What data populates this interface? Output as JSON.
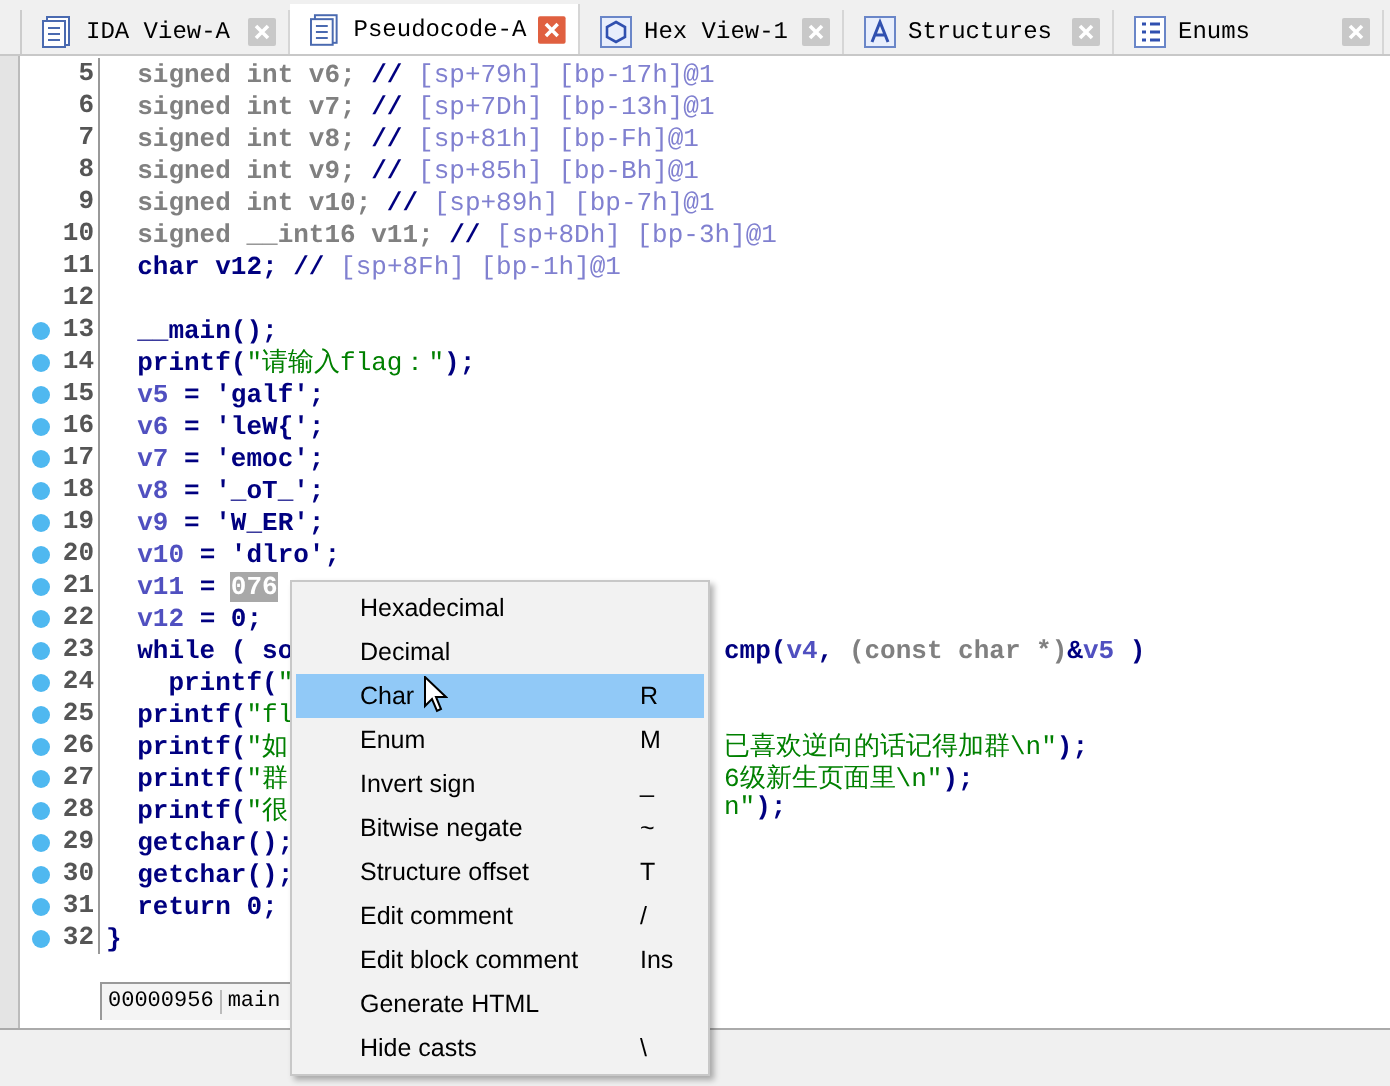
{
  "tabs": [
    {
      "label": "IDA View-A",
      "selected": false
    },
    {
      "label": "Pseudocode-A",
      "selected": true
    },
    {
      "label": "Hex View-1",
      "selected": false
    },
    {
      "label": "Structures",
      "selected": false
    },
    {
      "label": "Enums",
      "selected": false
    }
  ],
  "code": {
    "lines": [
      {
        "number": "5",
        "breakpoint": false,
        "segments": [
          {
            "t": "  signed int v6;",
            "kind": "decl"
          },
          {
            "t": " // ",
            "kind": "op"
          },
          {
            "t": "[sp+79h] [bp-17h]@1",
            "kind": "cmt"
          }
        ]
      },
      {
        "number": "6",
        "breakpoint": false,
        "segments": [
          {
            "t": "  signed int v7;",
            "kind": "decl"
          },
          {
            "t": " // ",
            "kind": "op"
          },
          {
            "t": "[sp+7Dh] [bp-13h]@1",
            "kind": "cmt"
          }
        ]
      },
      {
        "number": "7",
        "breakpoint": false,
        "segments": [
          {
            "t": "  signed int v8;",
            "kind": "decl"
          },
          {
            "t": " // ",
            "kind": "op"
          },
          {
            "t": "[sp+81h] [bp-Fh]@1",
            "kind": "cmt"
          }
        ]
      },
      {
        "number": "8",
        "breakpoint": false,
        "segments": [
          {
            "t": "  signed int v9;",
            "kind": "decl"
          },
          {
            "t": " // ",
            "kind": "op"
          },
          {
            "t": "[sp+85h] [bp-Bh]@1",
            "kind": "cmt"
          }
        ]
      },
      {
        "number": "9",
        "breakpoint": false,
        "segments": [
          {
            "t": "  signed int v10;",
            "kind": "decl"
          },
          {
            "t": " // ",
            "kind": "op"
          },
          {
            "t": "[sp+89h] [bp-7h]@1",
            "kind": "cmt"
          }
        ]
      },
      {
        "number": "10",
        "breakpoint": false,
        "segments": [
          {
            "t": "  signed __int16 v11;",
            "kind": "decl"
          },
          {
            "t": " // ",
            "kind": "op"
          },
          {
            "t": "[sp+8Dh] [bp-3h]@1",
            "kind": "cmt"
          }
        ]
      },
      {
        "number": "11",
        "breakpoint": false,
        "segments": [
          {
            "t": "  char v12;",
            "kind": "op"
          },
          {
            "t": " // ",
            "kind": "op"
          },
          {
            "t": "[sp+8Fh] [bp-1h]@1",
            "kind": "cmt"
          }
        ]
      },
      {
        "number": "12",
        "breakpoint": false
      },
      {
        "number": "13",
        "breakpoint": true,
        "segments": [
          {
            "t": "  __main();",
            "kind": "op"
          }
        ]
      },
      {
        "number": "14",
        "breakpoint": true,
        "segments": [
          {
            "t": "  printf(",
            "kind": "op"
          },
          {
            "t": "\"请输入flag：\"",
            "kind": "str"
          },
          {
            "t": ");",
            "kind": "op"
          }
        ]
      },
      {
        "number": "15",
        "breakpoint": true,
        "segments": [
          {
            "t": "  v5",
            "kind": "var"
          },
          {
            "t": " = 'galf';",
            "kind": "op"
          }
        ]
      },
      {
        "number": "16",
        "breakpoint": true,
        "segments": [
          {
            "t": "  v6",
            "kind": "var"
          },
          {
            "t": " = 'leW{';",
            "kind": "op"
          }
        ]
      },
      {
        "number": "17",
        "breakpoint": true,
        "segments": [
          {
            "t": "  v7",
            "kind": "var"
          },
          {
            "t": " = 'emoc';",
            "kind": "op"
          }
        ]
      },
      {
        "number": "18",
        "breakpoint": true,
        "segments": [
          {
            "t": "  v8",
            "kind": "var"
          },
          {
            "t": " = '_oT_';",
            "kind": "op"
          }
        ]
      },
      {
        "number": "19",
        "breakpoint": true,
        "segments": [
          {
            "t": "  v9",
            "kind": "var"
          },
          {
            "t": " = 'W_ER';",
            "kind": "op"
          }
        ]
      },
      {
        "number": "20",
        "breakpoint": true,
        "segments": [
          {
            "t": "  v10",
            "kind": "var"
          },
          {
            "t": " = 'dlro';",
            "kind": "op"
          }
        ]
      },
      {
        "number": "21",
        "breakpoint": true,
        "segments": [
          {
            "t": "  v11",
            "kind": "var"
          },
          {
            "t": " = ",
            "kind": "op"
          },
          {
            "t": "076",
            "kind": "sel"
          }
        ]
      },
      {
        "number": "22",
        "breakpoint": true,
        "segments": [
          {
            "t": "  v12",
            "kind": "var"
          },
          {
            "t": " = 0;",
            "kind": "op"
          }
        ]
      },
      {
        "number": "23",
        "breakpoint": true,
        "segments": [
          {
            "t": "  while ( so",
            "kind": "op"
          }
        ],
        "right": [
          {
            "t": "cmp(",
            "kind": "op"
          },
          {
            "t": "v4",
            "kind": "var"
          },
          {
            "t": ", ",
            "kind": "op"
          },
          {
            "t": "(const char *)",
            "kind": "decl"
          },
          {
            "t": "&",
            "kind": "op"
          },
          {
            "t": "v5",
            "kind": "var"
          },
          {
            "t": " )",
            "kind": "op"
          }
        ]
      },
      {
        "number": "24",
        "breakpoint": true,
        "segments": [
          {
            "t": "    printf(",
            "kind": "op"
          },
          {
            "t": "\"",
            "kind": "str"
          }
        ]
      },
      {
        "number": "25",
        "breakpoint": true,
        "segments": [
          {
            "t": "  printf(",
            "kind": "op"
          },
          {
            "t": "\"fl",
            "kind": "str"
          }
        ]
      },
      {
        "number": "26",
        "breakpoint": true,
        "segments": [
          {
            "t": "  printf(",
            "kind": "op"
          },
          {
            "t": "\"如",
            "kind": "str"
          }
        ],
        "right": [
          {
            "t": "已喜欢逆向的话记得加群\\n\"",
            "kind": "str"
          },
          {
            "t": ");",
            "kind": "op"
          }
        ]
      },
      {
        "number": "27",
        "breakpoint": true,
        "segments": [
          {
            "t": "  printf(",
            "kind": "op"
          },
          {
            "t": "\"群",
            "kind": "str"
          }
        ],
        "right": [
          {
            "t": "6级新生页面里\\n\"",
            "kind": "str"
          },
          {
            "t": ");",
            "kind": "op"
          }
        ]
      },
      {
        "number": "28",
        "breakpoint": true,
        "segments": [
          {
            "t": "  printf(",
            "kind": "op"
          },
          {
            "t": "\"很",
            "kind": "str"
          }
        ],
        "right": [
          {
            "t": "n\"",
            "kind": "str"
          },
          {
            "t": ");",
            "kind": "op"
          }
        ]
      },
      {
        "number": "29",
        "breakpoint": true,
        "segments": [
          {
            "t": "  getchar();",
            "kind": "op"
          }
        ]
      },
      {
        "number": "30",
        "breakpoint": true,
        "segments": [
          {
            "t": "  getchar();",
            "kind": "op"
          }
        ]
      },
      {
        "number": "31",
        "breakpoint": true,
        "segments": [
          {
            "t": "  return 0;",
            "kind": "op"
          }
        ]
      },
      {
        "number": "32",
        "breakpoint": true,
        "segments": [
          {
            "t": "}",
            "kind": "op"
          }
        ]
      }
    ]
  },
  "status": {
    "address": "00000956",
    "function": "main"
  },
  "context_menu": {
    "items": [
      {
        "label": "Hexadecimal",
        "selected": false
      },
      {
        "label": "Decimal",
        "selected": false
      },
      {
        "label": "Char",
        "shortcut": "R",
        "selected": true
      },
      {
        "label": "Enum",
        "shortcut": "M",
        "selected": false
      },
      {
        "label": "Invert sign",
        "shortcut": "_",
        "selected": false
      },
      {
        "label": "Bitwise negate",
        "shortcut": "~",
        "selected": false
      },
      {
        "label": "Structure offset",
        "shortcut": "T",
        "selected": false
      },
      {
        "label": "Edit comment",
        "shortcut": "/",
        "selected": false
      },
      {
        "label": "Edit block comment",
        "shortcut": "Ins",
        "selected": false
      },
      {
        "label": "Generate HTML",
        "selected": false
      },
      {
        "label": "Hide casts",
        "shortcut": "\\",
        "selected": false
      }
    ]
  }
}
